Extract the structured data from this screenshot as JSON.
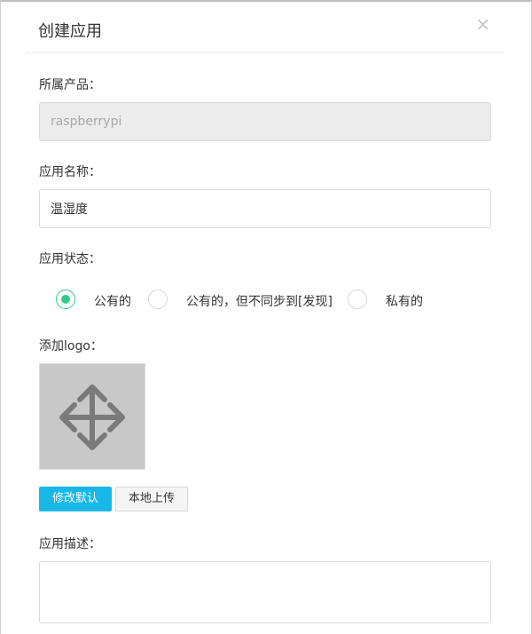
{
  "dialog": {
    "title": "创建应用",
    "close_label": "×"
  },
  "form": {
    "product": {
      "label": "所属产品：",
      "value": "raspberrypi",
      "disabled": true
    },
    "app_name": {
      "label": "应用名称：",
      "value": "温湿度"
    },
    "app_status": {
      "label": "应用状态：",
      "options": [
        {
          "label": "公有的",
          "selected": true
        },
        {
          "label": "公有的，但不同步到[发现]",
          "selected": false
        },
        {
          "label": "私有的",
          "selected": false
        }
      ]
    },
    "logo": {
      "label": "添加logo：",
      "icon": "move-arrows-icon",
      "modify_default_label": "修改默认",
      "local_upload_label": "本地上传"
    },
    "description": {
      "label": "应用描述：",
      "value": ""
    }
  },
  "colors": {
    "accent_radio": "#2ecc8a",
    "primary_button": "#17b8e8",
    "logo_placeholder_bg": "#c8c8c8",
    "logo_icon": "#7a7a7a"
  }
}
